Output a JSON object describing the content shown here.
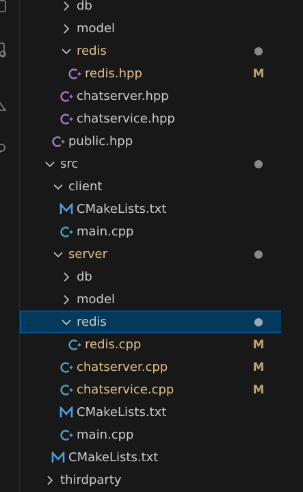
{
  "colors": {
    "background": "#181818",
    "selected_bg": "#04395e",
    "selected_border": "#0078d4",
    "modified_text": "#e2c08d",
    "text": "#cccccc",
    "cpp_icon": "#519aba",
    "hpp_icon": "#a074c4",
    "cmake_icon": "#4f9de0"
  },
  "activity_icons": [
    "files-icon",
    "search-icon",
    "git-icon",
    "debug-icon"
  ],
  "tree": [
    {
      "label": "db",
      "kind": "folder",
      "expanded": false,
      "depth": 2,
      "modified": false,
      "badge": ""
    },
    {
      "label": "model",
      "kind": "folder",
      "expanded": false,
      "depth": 2,
      "modified": false,
      "badge": ""
    },
    {
      "label": "redis",
      "kind": "folder",
      "expanded": true,
      "depth": 2,
      "modified": true,
      "badge": "dot"
    },
    {
      "label": "redis.hpp",
      "kind": "hpp",
      "depth": 3,
      "modified": true,
      "badge": "M"
    },
    {
      "label": "chatserver.hpp",
      "kind": "hpp",
      "depth": 2,
      "modified": false,
      "badge": ""
    },
    {
      "label": "chatservice.hpp",
      "kind": "hpp",
      "depth": 2,
      "modified": false,
      "badge": ""
    },
    {
      "label": "public.hpp",
      "kind": "hpp",
      "depth": 1,
      "modified": false,
      "badge": ""
    },
    {
      "label": "src",
      "kind": "folder",
      "expanded": true,
      "depth": 0,
      "modified": false,
      "badge": "dot"
    },
    {
      "label": "client",
      "kind": "folder",
      "expanded": true,
      "depth": 1,
      "modified": false,
      "badge": ""
    },
    {
      "label": "CMakeLists.txt",
      "kind": "cmake",
      "depth": 2,
      "modified": false,
      "badge": ""
    },
    {
      "label": "main.cpp",
      "kind": "cpp",
      "depth": 2,
      "modified": false,
      "badge": ""
    },
    {
      "label": "server",
      "kind": "folder",
      "expanded": true,
      "depth": 1,
      "modified": true,
      "badge": "dot"
    },
    {
      "label": "db",
      "kind": "folder",
      "expanded": false,
      "depth": 2,
      "modified": false,
      "badge": ""
    },
    {
      "label": "model",
      "kind": "folder",
      "expanded": false,
      "depth": 2,
      "modified": false,
      "badge": ""
    },
    {
      "label": "redis",
      "kind": "folder",
      "expanded": true,
      "depth": 2,
      "modified": false,
      "badge": "dot",
      "selected": true
    },
    {
      "label": "redis.cpp",
      "kind": "cpp",
      "depth": 3,
      "modified": true,
      "badge": "M"
    },
    {
      "label": "chatserver.cpp",
      "kind": "cpp",
      "depth": 2,
      "modified": true,
      "badge": "M"
    },
    {
      "label": "chatservice.cpp",
      "kind": "cpp",
      "depth": 2,
      "modified": true,
      "badge": "M"
    },
    {
      "label": "CMakeLists.txt",
      "kind": "cmake",
      "depth": 2,
      "modified": false,
      "badge": ""
    },
    {
      "label": "main.cpp",
      "kind": "cpp",
      "depth": 2,
      "modified": false,
      "badge": ""
    },
    {
      "label": "CMakeLists.txt",
      "kind": "cmake",
      "depth": 1,
      "modified": false,
      "badge": ""
    },
    {
      "label": "thirdparty",
      "kind": "folder",
      "expanded": false,
      "depth": 0,
      "modified": false,
      "badge": ""
    }
  ]
}
